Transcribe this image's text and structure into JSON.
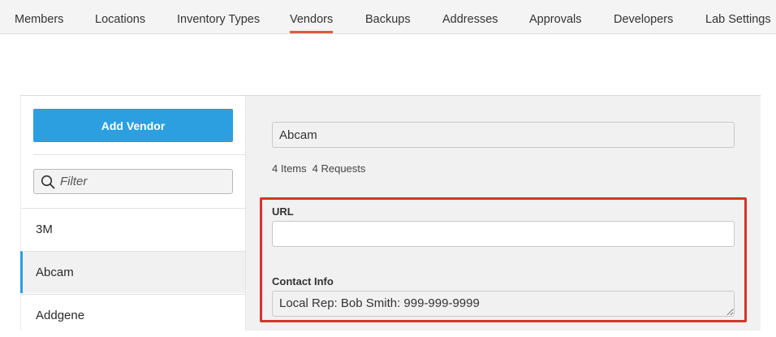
{
  "nav": {
    "tabs": [
      {
        "label": "Members"
      },
      {
        "label": "Locations"
      },
      {
        "label": "Inventory Types"
      },
      {
        "label": "Vendors",
        "active": true
      },
      {
        "label": "Backups"
      },
      {
        "label": "Addresses"
      },
      {
        "label": "Approvals"
      },
      {
        "label": "Developers"
      },
      {
        "label": "Lab Settings"
      }
    ]
  },
  "sidebar": {
    "add_button_label": "Add Vendor",
    "filter_placeholder": "Filter",
    "filter_icon": "search-icon",
    "vendors": [
      {
        "name": "3M"
      },
      {
        "name": "Abcam",
        "selected": true
      },
      {
        "name": "Addgene"
      }
    ]
  },
  "detail": {
    "name_value": "Abcam",
    "items_count": "4 Items",
    "requests_count": "4 Requests",
    "url_label": "URL",
    "url_value": "",
    "contact_label": "Contact Info",
    "contact_value": "Local Rep: Bob Smith: 999-999-9999"
  },
  "colors": {
    "accent_blue": "#2b9fe0",
    "active_tab_underline": "#e05a3c",
    "highlight_box": "#d9332a"
  }
}
